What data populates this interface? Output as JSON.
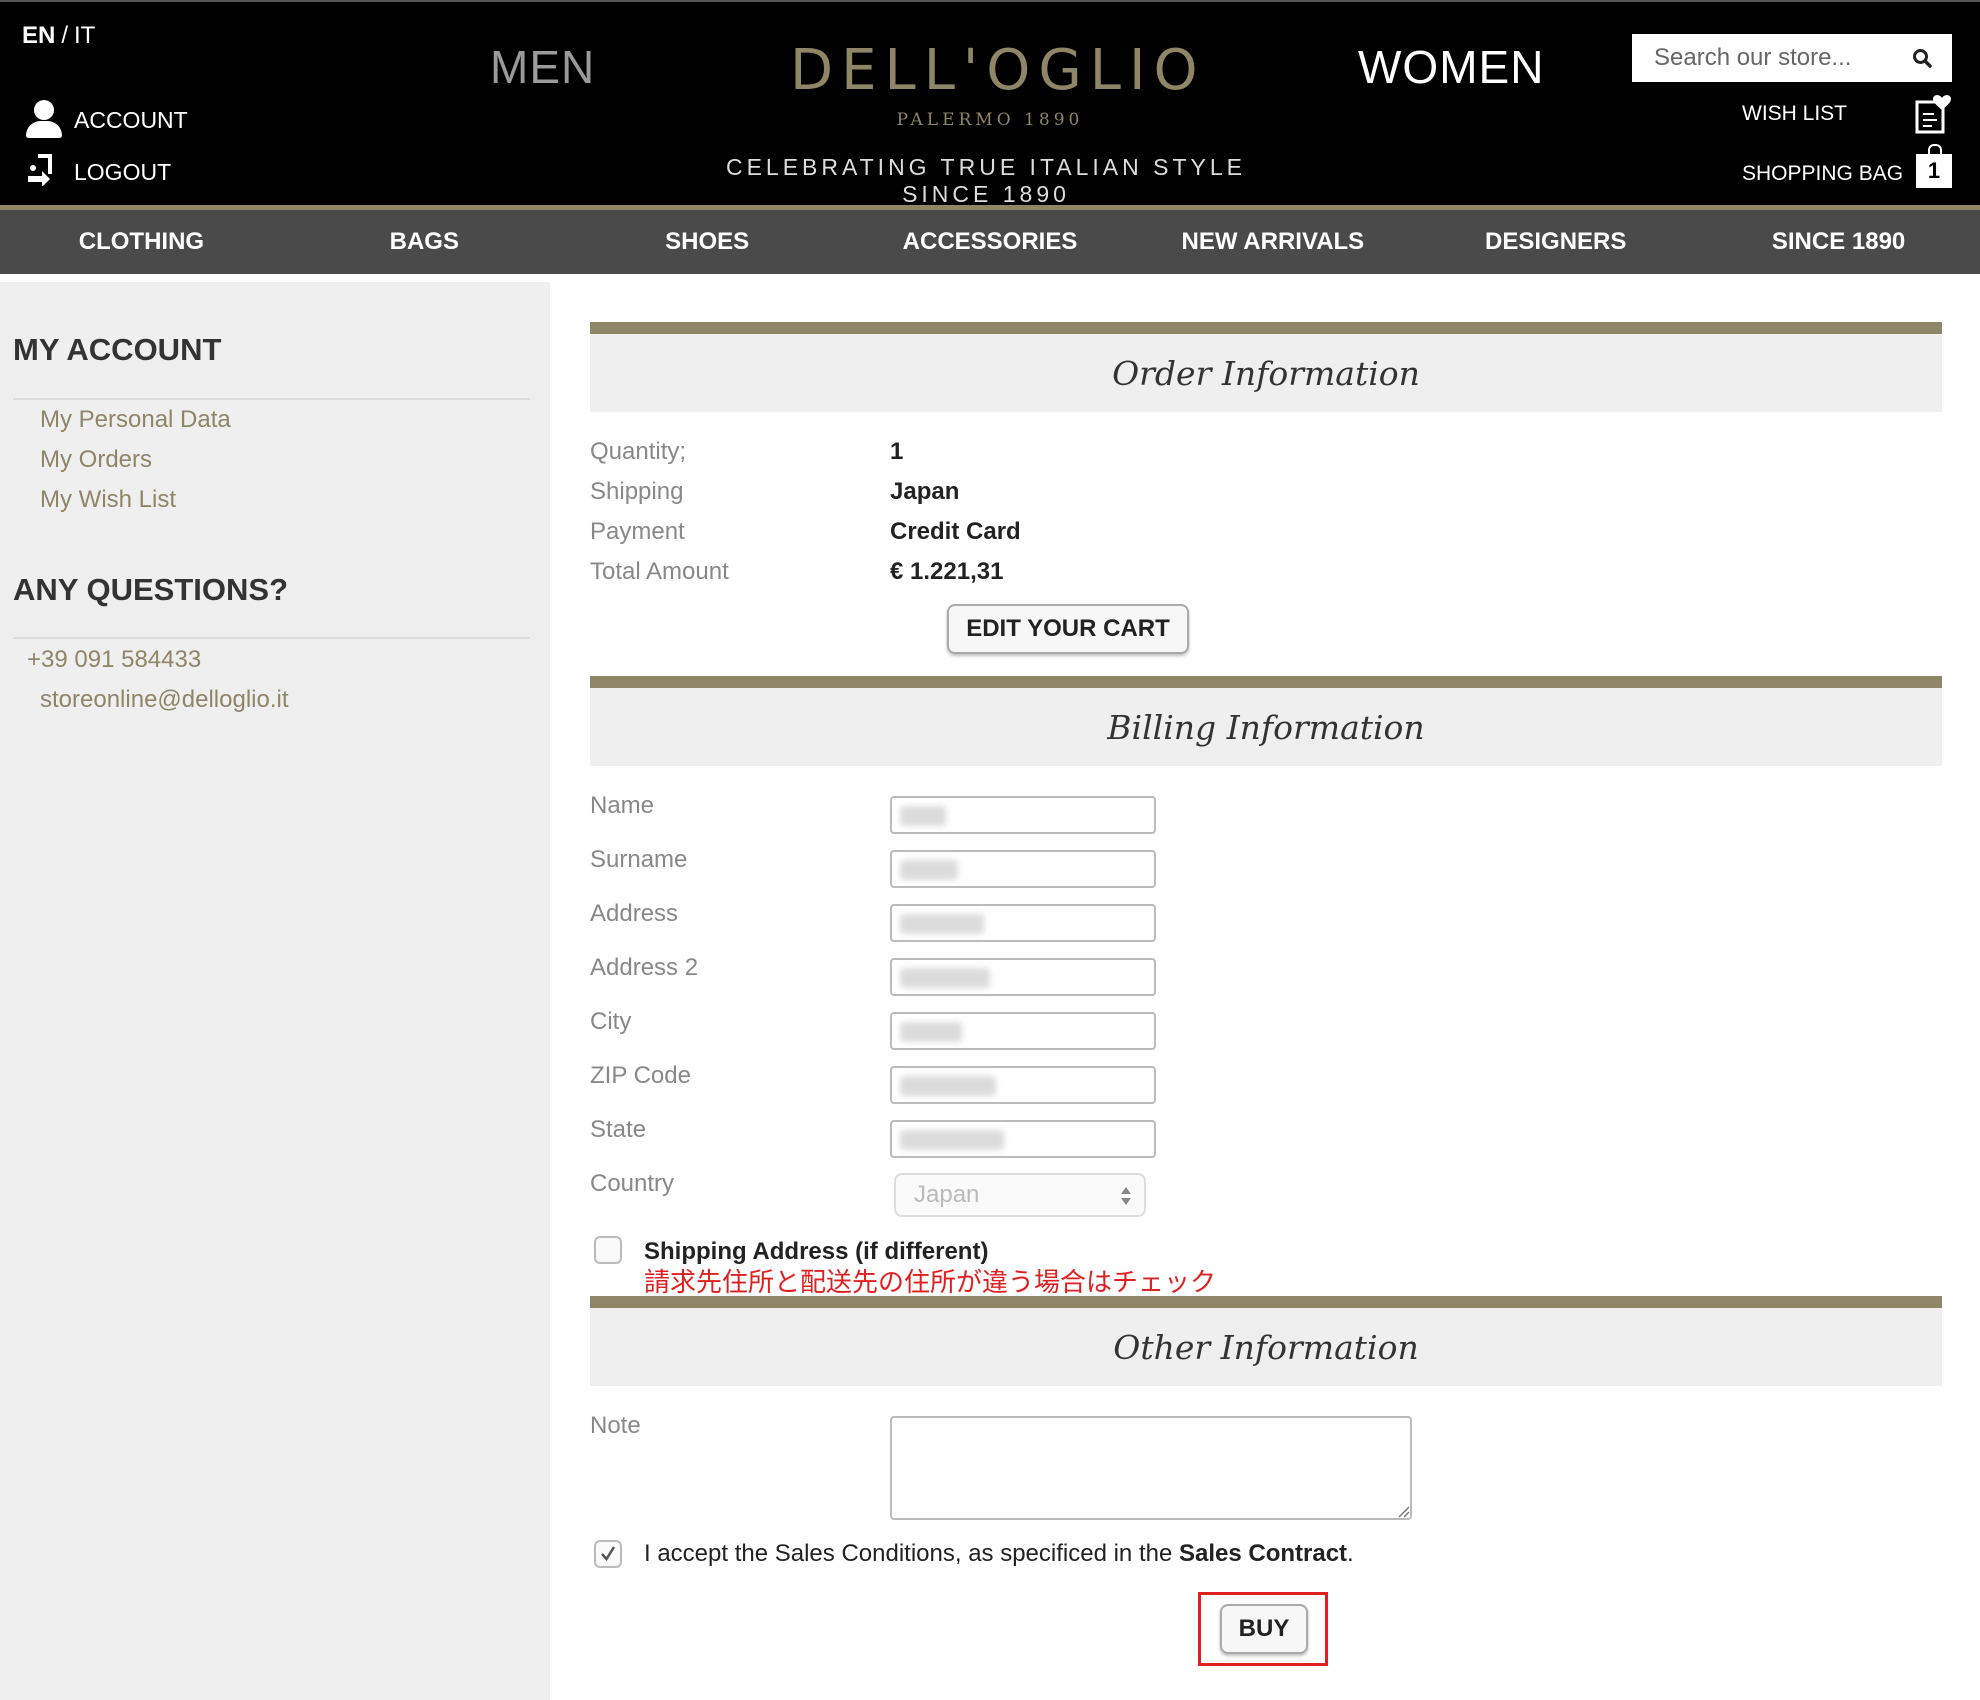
{
  "header": {
    "lang_active": "EN",
    "lang_separator": "/",
    "lang_alt": "IT",
    "account_label": "ACCOUNT",
    "logout_label": "LOGOUT",
    "nav_men": "MEN",
    "nav_women": "WOMEN",
    "logo_word": "DELL'OGLIO",
    "logo_sub": "PALERMO 1890",
    "tagline": "CELEBRATING TRUE ITALIAN STYLE SINCE 1890",
    "search_placeholder": "Search our store...",
    "wish_list_label": "WISH LIST",
    "shopping_bag_label": "SHOPPING BAG",
    "bag_count": "1"
  },
  "categories": [
    "CLOTHING",
    "BAGS",
    "SHOES",
    "ACCESSORIES",
    "NEW ARRIVALS",
    "DESIGNERS",
    "SINCE 1890"
  ],
  "sidebar": {
    "my_account_title": "MY ACCOUNT",
    "links": [
      "My Personal Data",
      "My Orders",
      "My Wish List"
    ],
    "questions_title": "ANY QUESTIONS?",
    "phone": "+39 091 584433",
    "email": "storeonline@delloglio.it"
  },
  "order": {
    "title": "Order Information",
    "rows": [
      {
        "label": "Quantity;",
        "value": "1"
      },
      {
        "label": "Shipping",
        "value": "Japan"
      },
      {
        "label": "Payment",
        "value": "Credit Card"
      },
      {
        "label": "Total Amount",
        "value": "€ 1.221,31"
      }
    ],
    "edit_cart_label": "EDIT YOUR CART"
  },
  "billing": {
    "title": "Billing Information",
    "fields": [
      "Name",
      "Surname",
      "Address",
      "Address 2",
      "City",
      "ZIP Code",
      "State"
    ],
    "country_label": "Country",
    "country_value": "Japan",
    "shipping_diff_label": "Shipping Address (if different)",
    "annotation": "請求先住所と配送先の住所が違う場合はチェック"
  },
  "other": {
    "title": "Other Information",
    "note_label": "Note",
    "accept_text_pre": "I accept the Sales Conditions, as specificed in the ",
    "accept_link": "Sales Contract",
    "accept_text_post": ".",
    "accept_checked": true,
    "buy_label": "BUY"
  },
  "colors": {
    "gold": "#8f8567",
    "header_bg": "#000000",
    "category_bar": "#4a4a4a",
    "sidebar_bg": "#efefef",
    "annotation_red": "#e02020"
  }
}
